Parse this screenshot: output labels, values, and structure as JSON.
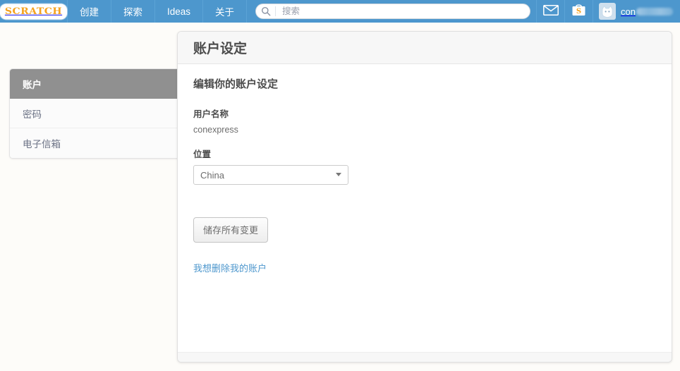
{
  "navbar": {
    "logo_text": "SCRATCH",
    "items": [
      {
        "label": "创建",
        "name": "nav-create"
      },
      {
        "label": "探索",
        "name": "nav-explore"
      },
      {
        "label": "Ideas",
        "name": "nav-ideas"
      },
      {
        "label": "关于",
        "name": "nav-about"
      }
    ],
    "search": {
      "placeholder": "搜索",
      "value": "",
      "icon": "search-icon"
    },
    "messages_icon": "envelope-icon",
    "backpack_icon": "backpack-s-icon",
    "account": {
      "name_visible": "con",
      "avatar_icon": "cat-avatar-icon",
      "caret_icon": "chevron-down-icon"
    },
    "bg_color": "#4d97cd"
  },
  "settings_nav": {
    "items": [
      {
        "label": "账户",
        "active": true
      },
      {
        "label": "密码",
        "active": false
      },
      {
        "label": "电子信箱",
        "active": false
      }
    ],
    "active_bg": "#909090"
  },
  "card": {
    "title": "账户设定",
    "section_heading": "编辑你的账户设定",
    "username_label": "用户名称",
    "username_value": "conexpress",
    "location_label": "位置",
    "location_value": "China",
    "location_options": [
      "China"
    ],
    "save_label": "储存所有变更",
    "delete_link": "我想删除我的账户",
    "link_color": "#4d97cd"
  }
}
